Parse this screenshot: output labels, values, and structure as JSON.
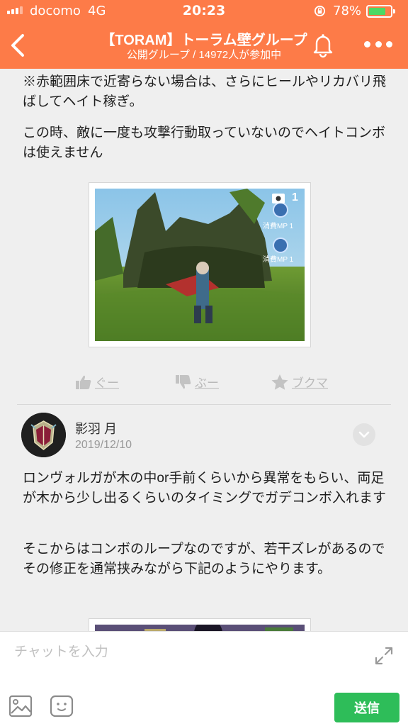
{
  "status_bar": {
    "carrier": "docomo",
    "network": "4G",
    "time": "20:23",
    "battery_percent": "78%",
    "battery_level": 0.78
  },
  "header": {
    "title": "【TORAM】トーラム壁グループ",
    "subtitle": "公開グループ / 14972人が参加中",
    "back_icon": "chevron-left-icon",
    "bell_icon": "bell-icon",
    "more_icon": "more-dots-icon"
  },
  "post1": {
    "paragraph1": "※赤範囲床で近寄らない場合は、さらにヒールやリカバリ飛ばしてヘイト稼ぎ。",
    "paragraph2": "この時、敵に一度も攻撃行動取っていないのでヘイトコンボは使えません",
    "image_badge_count": "1",
    "hud_label_1": "消費MP 1",
    "hud_label_2": "消費MP 1"
  },
  "reactions": {
    "good": "ぐー",
    "boo": "ぶー",
    "bookmark": "ブクマ"
  },
  "post2": {
    "author": "影羽 月",
    "date": "2019/12/10",
    "paragraph1": "ロンヴォルガが木の中or手前くらいから異常をもらい、両足が木から少し出るくらいのタイミングでガデコンボ入れます",
    "paragraph2": "そこからはコンボのループなのですが、若干ズレがあるのでその修正を通常挟みながら下記のようにやります。"
  },
  "input_bar": {
    "placeholder": "チャットを入力",
    "send_label": "送信"
  },
  "colors": {
    "header_bg": "#fd7b48",
    "send_bg": "#2ebd59",
    "battery": "#4cd964"
  }
}
